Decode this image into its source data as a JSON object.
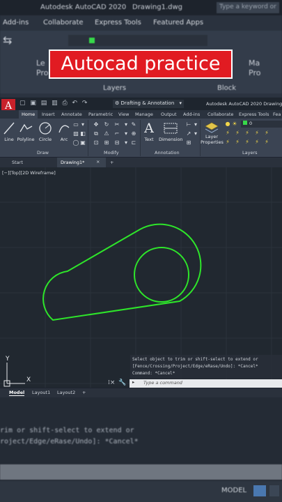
{
  "bg_top": {
    "title_left": "Autodesk AutoCAD 2020",
    "title_doc": "Drawing1.dwg",
    "search_placeholder": "Type a keyword or",
    "tabs": [
      "Add-ins",
      "Collaborate",
      "Express Tools",
      "Featured Apps"
    ],
    "panel_labels": [
      "Layers",
      "Block"
    ],
    "ribbon_labels": [
      "Le",
      "Pro",
      "Ma",
      "Pro"
    ]
  },
  "banner": {
    "text": "Autocad practice"
  },
  "app": {
    "logo": "A",
    "workspace": "Drafting & Annotation",
    "title": "Autodesk AutoCAD 2020   Drawing1.",
    "ribbon_tabs": [
      "Home",
      "Insert",
      "Annotate",
      "Parametric",
      "View",
      "Manage",
      "Output",
      "Add-ins",
      "Collaborate",
      "Express Tools",
      "Fea"
    ],
    "draw_tools": [
      "Line",
      "Polyline",
      "Circle",
      "Arc"
    ],
    "annotation_tools": [
      "Text",
      "Dimension"
    ],
    "layer_props": [
      "Layer",
      "Properties"
    ],
    "layer_value": "0",
    "panels": [
      "Draw",
      "Modify",
      "Annotation",
      "Layers"
    ]
  },
  "doc_tabs": [
    "Start",
    "Drawing1*",
    "+"
  ],
  "viewport": {
    "label": "[−][Top][2D Wireframe]",
    "ucs_x": "X",
    "ucs_y": "Y"
  },
  "command": {
    "history": [
      "Select object to trim or shift-select to extend or",
      "[Fence/Crossing/Project/Edge/eRase/Undo]: *Cancel*",
      "Command: *Cancel*"
    ],
    "placeholder": "Type a command"
  },
  "layout_tabs": [
    "Model",
    "Layout1",
    "Layout2",
    "+"
  ],
  "bottom": {
    "zoom_lines": [
      "rim or shift-select to extend or",
      "roject/Edge/eRase/Undo]: *Cancel*"
    ],
    "status_model": "MODEL"
  },
  "colors": {
    "shape": "#2ee62a",
    "banner_bg": "#e11b22",
    "viewport_bg": "#212830"
  }
}
